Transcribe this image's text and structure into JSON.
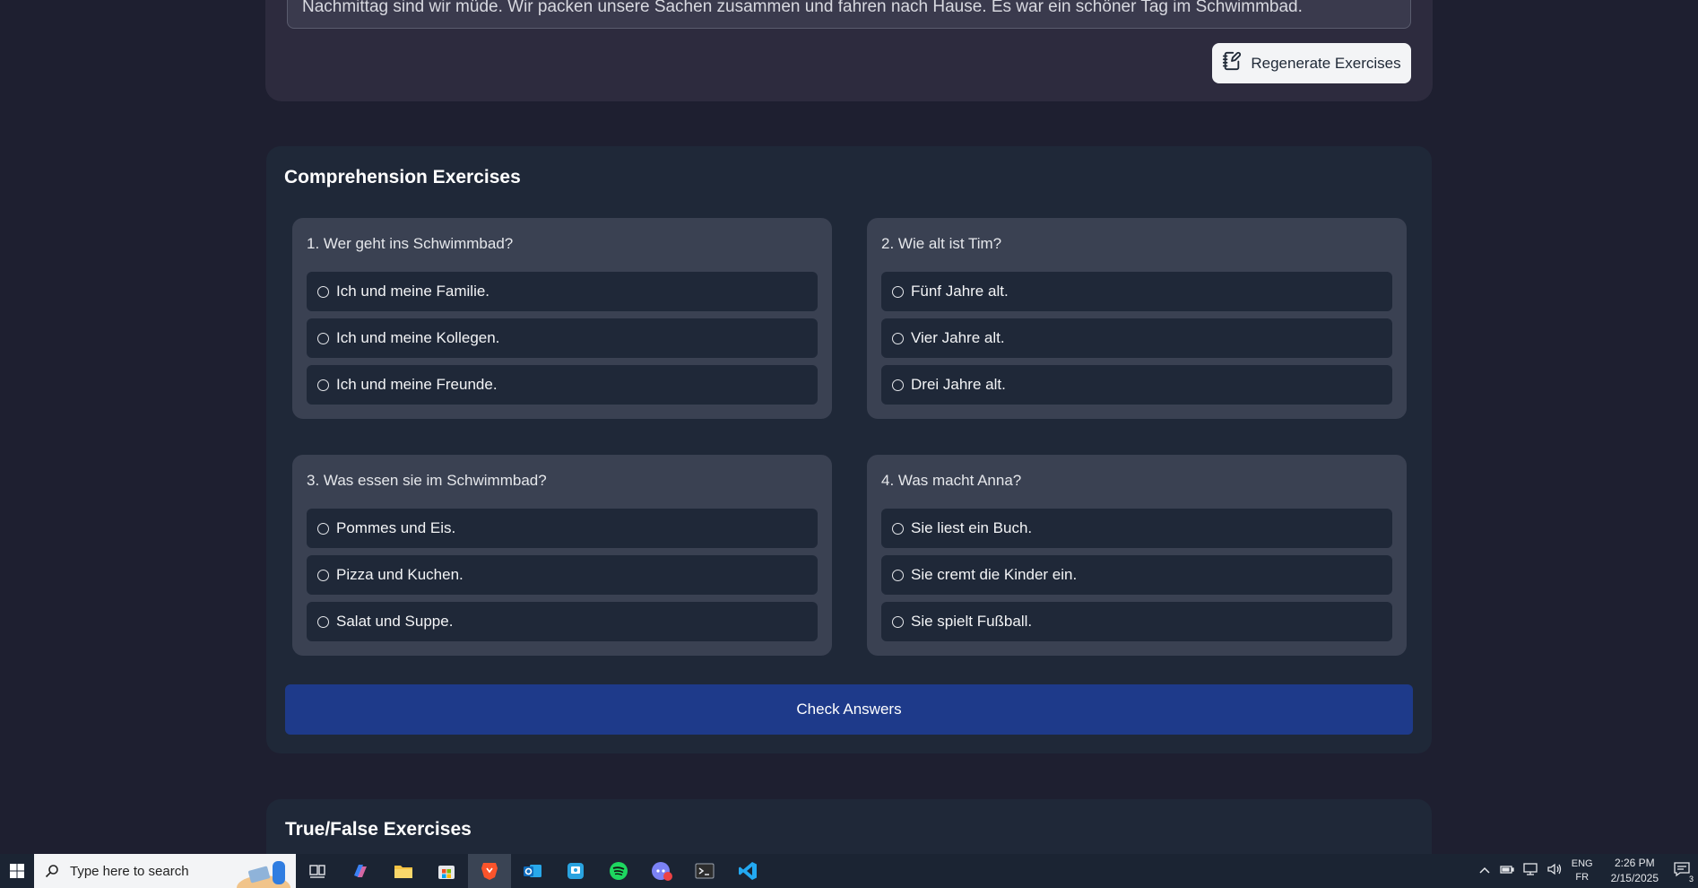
{
  "story": {
    "text": "Nachmittag sind wir müde. Wir packen unsere Sachen zusammen und fahren nach Hause. Es war ein schöner Tag im Schwimmbad."
  },
  "regenerate_label": "Regenerate Exercises",
  "comprehension": {
    "title": "Comprehension Exercises",
    "questions": [
      {
        "text": "1. Wer geht ins Schwimmbad?",
        "options": [
          "Ich und meine Familie.",
          "Ich und meine Kollegen.",
          "Ich und meine Freunde."
        ]
      },
      {
        "text": "2. Wie alt ist Tim?",
        "options": [
          "Fünf Jahre alt.",
          "Vier Jahre alt.",
          "Drei Jahre alt."
        ]
      },
      {
        "text": "3. Was essen sie im Schwimmbad?",
        "options": [
          "Pommes und Eis.",
          "Pizza und Kuchen.",
          "Salat und Suppe."
        ]
      },
      {
        "text": "4. Was macht Anna?",
        "options": [
          "Sie liest ein Buch.",
          "Sie cremt die Kinder ein.",
          "Sie spielt Fußball."
        ]
      }
    ],
    "check_label": "Check Answers"
  },
  "true_false": {
    "title": "True/False Exercises"
  },
  "taskbar": {
    "search_placeholder": "Type here to search",
    "lang_top": "ENG",
    "lang_bottom": "FR",
    "time": "2:26 PM",
    "date": "2/15/2025",
    "notification_count": "3"
  },
  "colors": {
    "page_bg": "#1e1f30",
    "card_bg": "#1f2838",
    "question_bg": "#3a4152",
    "primary_button": "#1e3a8a"
  }
}
